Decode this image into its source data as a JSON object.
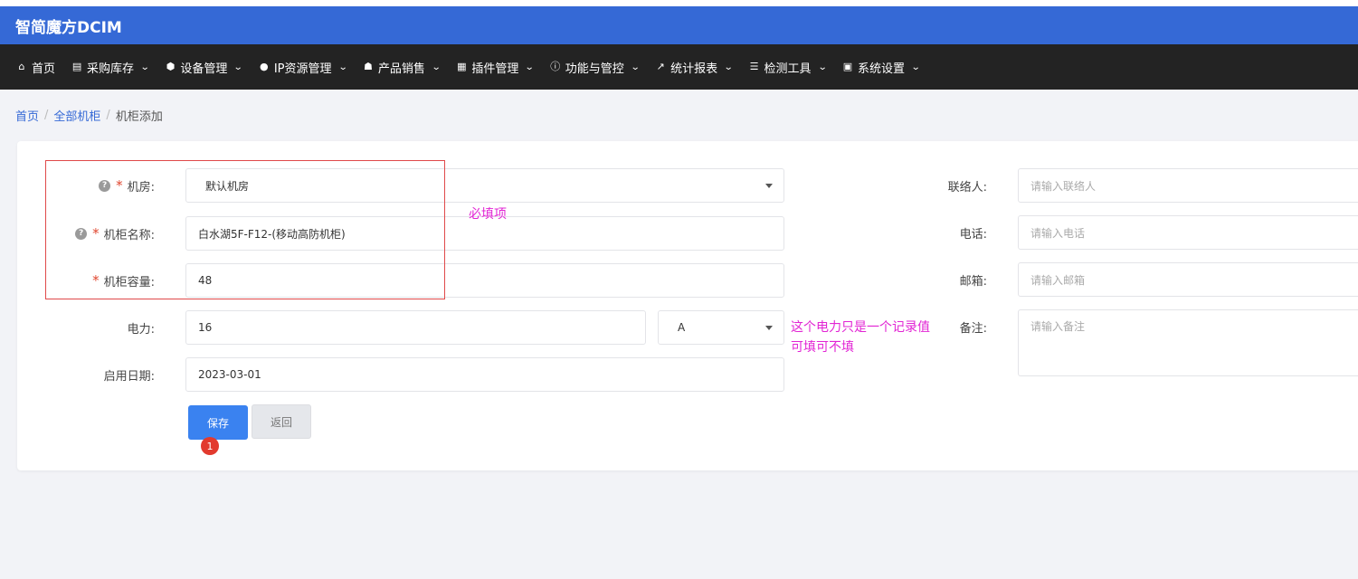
{
  "app": {
    "title": "智简魔方DCIM"
  },
  "nav": {
    "items": [
      {
        "label": "首页",
        "icon": "home-icon",
        "dropdown": false
      },
      {
        "label": "采购库存",
        "icon": "inbox-icon",
        "dropdown": true
      },
      {
        "label": "设备管理",
        "icon": "cube-icon",
        "dropdown": true
      },
      {
        "label": "IP资源管理",
        "icon": "map-marker-icon",
        "dropdown": true
      },
      {
        "label": "产品销售",
        "icon": "cart-icon",
        "dropdown": true
      },
      {
        "label": "插件管理",
        "icon": "grid-icon",
        "dropdown": true
      },
      {
        "label": "功能与管控",
        "icon": "info-icon",
        "dropdown": true
      },
      {
        "label": "统计报表",
        "icon": "line-chart-icon",
        "dropdown": true
      },
      {
        "label": "检测工具",
        "icon": "list-icon",
        "dropdown": true
      },
      {
        "label": "系统设置",
        "icon": "th-large-icon",
        "dropdown": true
      }
    ]
  },
  "breadcrumb": {
    "home": "首页",
    "parent": "全部机柜",
    "current": "机柜添加"
  },
  "form": {
    "room": {
      "label": "机房:",
      "value": "默认机房"
    },
    "cabinet_name": {
      "label": "机柜名称:",
      "value": "白水湖5F-F12-(移动高防机柜)"
    },
    "capacity": {
      "label": "机柜容量:",
      "value": "48"
    },
    "power": {
      "label": "电力:",
      "value": "16",
      "unit": "A"
    },
    "start_date": {
      "label": "启用日期:",
      "value": "2023-03-01"
    },
    "contact": {
      "label": "联络人:",
      "placeholder": "请输入联络人"
    },
    "phone": {
      "label": "电话:",
      "placeholder": "请输入电话"
    },
    "email": {
      "label": "邮箱:",
      "placeholder": "请输入邮箱"
    },
    "remark": {
      "label": "备注:",
      "placeholder": "请输入备注"
    },
    "required_mark": "*",
    "help_mark": "?",
    "save_label": "保存",
    "back_label": "返回"
  },
  "annotations": {
    "required_note": "必填项",
    "power_note_line1": "这个电力只是一个记录值",
    "power_note_line2": "可填可不填",
    "step_badge": "1"
  },
  "colors": {
    "brand": "#3569d6",
    "navbar": "#232323",
    "primary_button": "#3a82f0",
    "annotation_text": "#e224d4",
    "annotation_box": "#e0494a",
    "required": "#e0462f"
  }
}
